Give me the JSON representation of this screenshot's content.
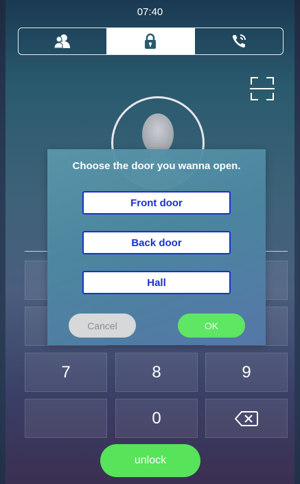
{
  "status_bar": {
    "time": "07:40"
  },
  "tabs": [
    {
      "icon": "contacts-icon",
      "active": false
    },
    {
      "icon": "lock-icon",
      "active": true
    },
    {
      "icon": "phone-call-icon",
      "active": false
    }
  ],
  "keypad": {
    "keys": [
      "7",
      "8",
      "9",
      "0"
    ],
    "delete_icon": "backspace-icon"
  },
  "unlock_label": "unlock",
  "dialog": {
    "title": "Choose the door you wanna open.",
    "doors": [
      "Front door",
      "Back door",
      "Hall"
    ],
    "cancel_label": "Cancel",
    "ok_label": "OK"
  },
  "colors": {
    "accent_green": "#57e35a",
    "door_text_blue": "#1a2fd0"
  }
}
